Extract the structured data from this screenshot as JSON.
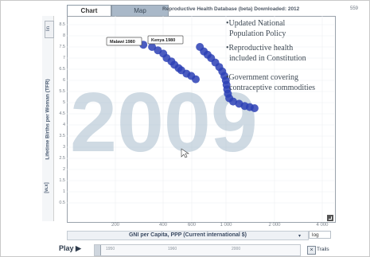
{
  "tabs": [
    {
      "label": "Chart",
      "active": true
    },
    {
      "label": "Map",
      "active": false
    }
  ],
  "header": {
    "title": "Reproductive Health Database (beta) Downloaded: 2012",
    "tail": "559"
  },
  "y_axis": {
    "label": "Lifetime Births per Woman (TFR)",
    "unit": "[w.x]",
    "scale_label": "lin",
    "ticks": [
      "8.5",
      "8",
      "7.5",
      "7",
      "6.5",
      "6",
      "5.5",
      "5",
      "4.5",
      "4",
      "3.5",
      "3",
      "2.5",
      "2",
      "1.5",
      "1",
      "0.5"
    ]
  },
  "x_axis": {
    "label": "GNI per Capita, PPP (Current international $)",
    "scale": "log",
    "ticks": [
      "200",
      "400",
      "600",
      "1 000",
      "2 000",
      "4 000"
    ]
  },
  "year_watermark": "2009",
  "callouts": [
    "Malawi 1980",
    "Kenya 1980"
  ],
  "annotations": [
    [
      "•Updated National",
      "Population Policy"
    ],
    [
      "•Reproductive health",
      "included in Constitution"
    ],
    [
      "•Government covering",
      "contraceptive commodities"
    ]
  ],
  "bubble_color": "#2b3fb5",
  "trails": {
    "malawi": [
      [
        300,
        7.6
      ],
      [
        340,
        7.5
      ],
      [
        370,
        7.35
      ],
      [
        400,
        7.2
      ],
      [
        420,
        7.0
      ],
      [
        450,
        6.85
      ],
      [
        470,
        6.7
      ],
      [
        500,
        6.55
      ],
      [
        520,
        6.45
      ],
      [
        560,
        6.3
      ],
      [
        600,
        6.2
      ],
      [
        640,
        6.05
      ]
    ],
    "kenya": [
      [
        680,
        7.5
      ],
      [
        720,
        7.3
      ],
      [
        760,
        7.15
      ],
      [
        800,
        7.0
      ],
      [
        850,
        6.8
      ],
      [
        900,
        6.6
      ],
      [
        940,
        6.4
      ],
      [
        970,
        6.2
      ],
      [
        990,
        6.0
      ],
      [
        1000,
        5.8
      ],
      [
        1010,
        5.6
      ],
      [
        1020,
        5.4
      ],
      [
        1040,
        5.2
      ],
      [
        1100,
        5.05
      ],
      [
        1200,
        4.95
      ],
      [
        1300,
        4.85
      ],
      [
        1400,
        4.8
      ],
      [
        1500,
        4.75
      ]
    ]
  },
  "controls": {
    "play_label": "Play ▶",
    "timeline_labels": [
      "1950",
      "1960",
      "2000"
    ],
    "trails_label": "Trails",
    "log_option": "log"
  }
}
